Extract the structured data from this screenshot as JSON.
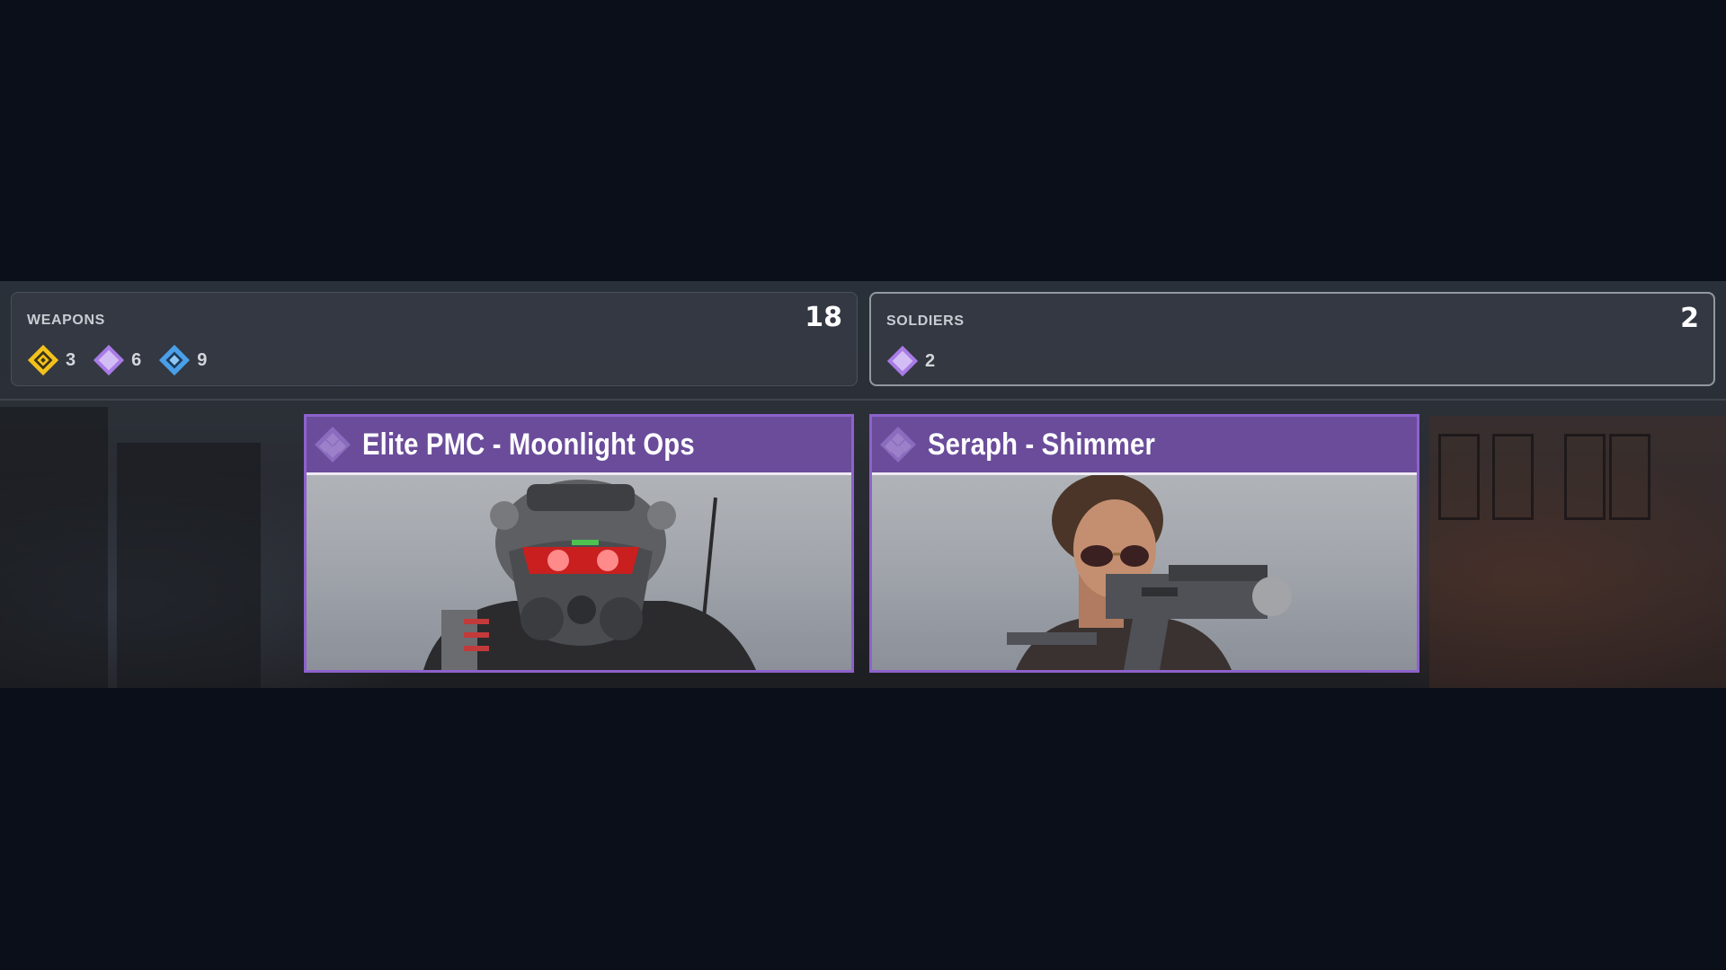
{
  "summary": {
    "weapons": {
      "label": "WEAPONS",
      "count": "18",
      "rarities": [
        {
          "icon": "gold-rarity-diamond-icon",
          "color": "#f2c21c",
          "value": "3"
        },
        {
          "icon": "purple-rarity-diamond-icon",
          "color": "#a97be6",
          "value": "6"
        },
        {
          "icon": "blue-rarity-diamond-icon",
          "color": "#4a9fe8",
          "value": "9"
        }
      ]
    },
    "soldiers": {
      "label": "SOLDIERS",
      "count": "2",
      "rarities": [
        {
          "icon": "purple-rarity-diamond-icon",
          "color": "#a97be6",
          "value": "2"
        }
      ]
    }
  },
  "cards": [
    {
      "title": "Elite PMC - Moonlight Ops",
      "rarity_icon": "purple-rarity-diamond-icon",
      "image": "gas-mask-soldier-portrait"
    },
    {
      "title": "Seraph - Shimmer",
      "rarity_icon": "purple-rarity-diamond-icon",
      "image": "sunglasses-soldier-with-smg-portrait"
    }
  ],
  "colors": {
    "background": "#0b0f19",
    "accent_purple": "#6a4c9a",
    "card_border": "#8e62cc"
  }
}
